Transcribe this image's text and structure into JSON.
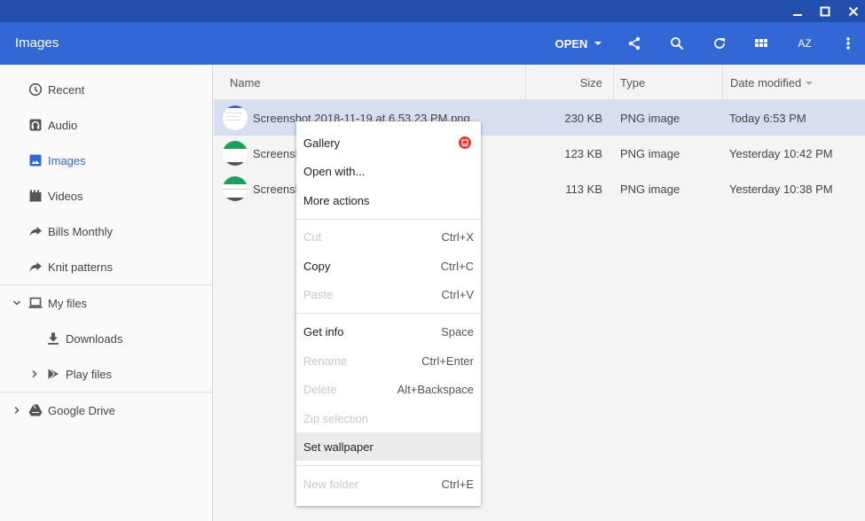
{
  "window": {
    "controls": [
      "minimize",
      "maximize",
      "close"
    ]
  },
  "header": {
    "title": "Images",
    "open_label": "OPEN",
    "icons": [
      "share-icon",
      "search-icon",
      "refresh-icon",
      "grid-view-icon",
      "sort-az-icon",
      "more-vert-icon"
    ],
    "sort_label": "AZ"
  },
  "sidebar": {
    "items": [
      {
        "label": "Recent",
        "icon": "clock-icon"
      },
      {
        "label": "Audio",
        "icon": "headphones-icon"
      },
      {
        "label": "Images",
        "icon": "image-icon",
        "active": true
      },
      {
        "label": "Videos",
        "icon": "clapperboard-icon"
      },
      {
        "label": "Bills Monthly",
        "icon": "shortcut-arrow-icon"
      },
      {
        "label": "Knit patterns",
        "icon": "shortcut-arrow-icon"
      }
    ],
    "my_files": {
      "label": "My files",
      "children": [
        {
          "label": "Downloads"
        },
        {
          "label": "Play files"
        }
      ]
    },
    "google_drive": {
      "label": "Google Drive"
    }
  },
  "list": {
    "columns": {
      "name": "Name",
      "size": "Size",
      "type": "Type",
      "date": "Date modified"
    },
    "rows": [
      {
        "name": "Screenshot 2018-11-19 at 6.53.23 PM.png",
        "size": "230 KB",
        "type": "PNG image",
        "date": "Today 6:53 PM",
        "selected": true
      },
      {
        "name": "Screenshot",
        "size": "123 KB",
        "type": "PNG image",
        "date": "Yesterday 10:42 PM"
      },
      {
        "name": "Screenshot",
        "size": "113 KB",
        "type": "PNG image",
        "date": "Yesterday 10:38 PM"
      }
    ]
  },
  "menu": {
    "items": [
      {
        "label": "Gallery",
        "shortcut": ""
      },
      {
        "label": "Open with...",
        "shortcut": ""
      },
      {
        "label": "More actions",
        "shortcut": ""
      },
      {
        "label": "Cut",
        "shortcut": "Ctrl+X",
        "disabled": true
      },
      {
        "label": "Copy",
        "shortcut": "Ctrl+C"
      },
      {
        "label": "Paste",
        "shortcut": "Ctrl+V",
        "disabled": true
      },
      {
        "label": "Get info",
        "shortcut": "Space"
      },
      {
        "label": "Rename",
        "shortcut": "Ctrl+Enter",
        "disabled": true
      },
      {
        "label": "Delete",
        "shortcut": "Alt+Backspace",
        "disabled": true
      },
      {
        "label": "Zip selection",
        "shortcut": "",
        "disabled": true
      },
      {
        "label": "Set wallpaper",
        "shortcut": "",
        "hover": true
      },
      {
        "label": "New folder",
        "shortcut": "Ctrl+E",
        "disabled": true
      }
    ]
  },
  "colors": {
    "titlebar": "#234fac",
    "header": "#3367d6",
    "accent": "#3367d6",
    "selected_row": "#d6deef",
    "gallery_badge": "#e53935"
  }
}
